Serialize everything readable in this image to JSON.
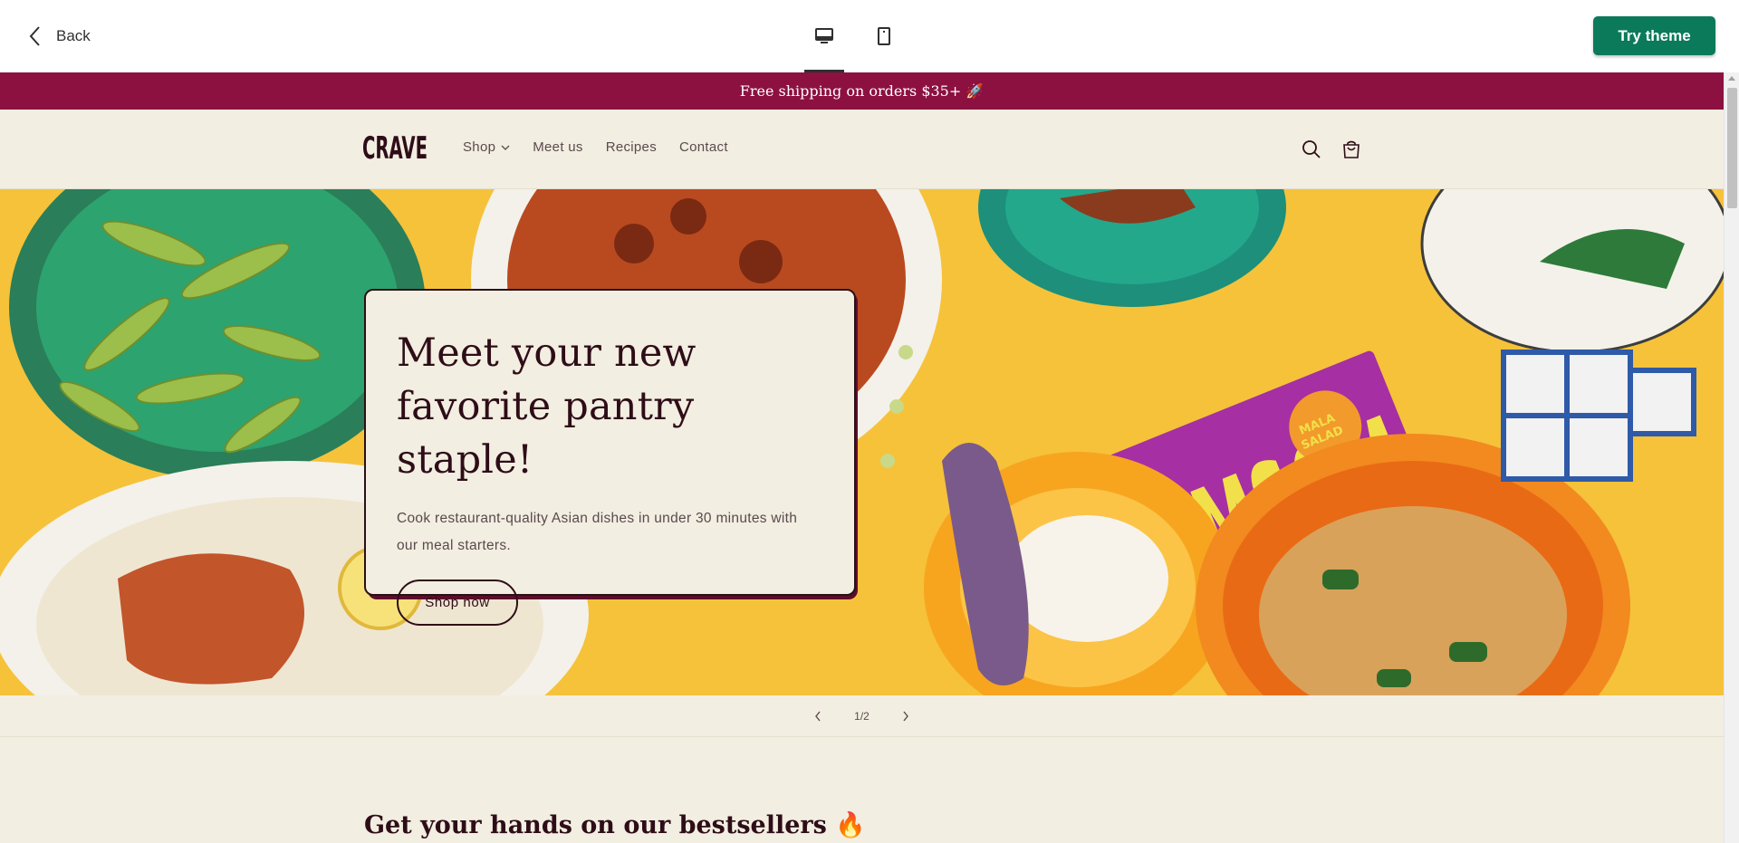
{
  "topbar": {
    "back_label": "Back",
    "try_label": "Try theme",
    "devices": [
      "desktop-icon",
      "mobile-icon"
    ],
    "accent": "#0b7a5a"
  },
  "store": {
    "announcement": "Free shipping on orders $35+ 🚀",
    "logo_text": "CRAVE",
    "nav": [
      {
        "label": "Shop"
      },
      {
        "label": "Meet us"
      },
      {
        "label": "Recipes"
      },
      {
        "label": "Contact"
      }
    ],
    "colors": {
      "announcement_bg": "#8c1141",
      "page_bg": "#f2eee1",
      "text": "#2e0d18"
    }
  },
  "hero": {
    "title_line1": "Meet your new",
    "title_line2": "favorite pantry staple!",
    "subtitle": "Cook restaurant-quality Asian dishes in under 30 minutes with our meal starters.",
    "button_label": "Shop now",
    "package_text": "OMSOM",
    "package_badge": "MALA SALAD"
  },
  "slider": {
    "counter": "1/2"
  },
  "section": {
    "title": "Get your hands on our bestsellers 🔥"
  }
}
